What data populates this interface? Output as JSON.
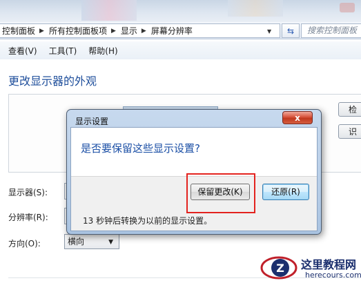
{
  "address_bar": {
    "breadcrumbs": [
      "控制面板",
      "所有控制面板项",
      "显示",
      "屏幕分辨率"
    ],
    "search_placeholder": "搜索控制面板"
  },
  "menu": {
    "items": [
      "查看(V)",
      "工具(T)",
      "帮助(H)"
    ]
  },
  "page": {
    "heading": "更改显示器的外观",
    "side_buttons": [
      "检",
      "识"
    ],
    "fields": {
      "display_label": "显示器(S):",
      "resolution_label": "分辨率(R):",
      "orientation_label": "方向(O):",
      "orientation_value": "横向"
    }
  },
  "dialog": {
    "title": "显示设置",
    "close_label": "x",
    "question": "是否要保留这些显示设置?",
    "keep_button": "保留更改(K)",
    "revert_button": "还原(R)",
    "countdown": "13 秒钟后转换为以前的显示设置。"
  },
  "watermark": {
    "name": "这里教程网",
    "url": "herecours.com"
  },
  "colors": {
    "heading_blue": "#1e4e9b",
    "highlight_red": "#e3221e",
    "close_red": "#c0381f"
  },
  "icons": [
    "chevron-right-icon",
    "chevron-down-icon",
    "refresh-icon",
    "close-icon",
    "monitor-icon",
    "logo-icon"
  ]
}
